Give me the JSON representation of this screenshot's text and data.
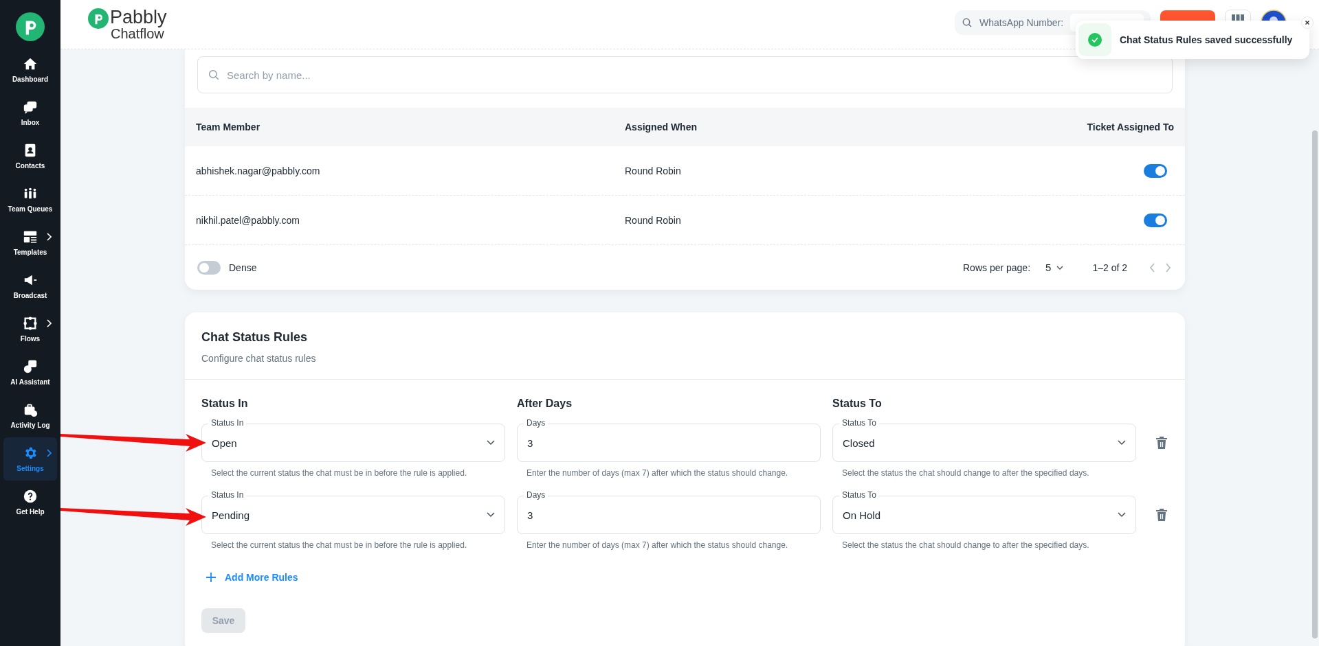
{
  "sidebar": {
    "items": [
      {
        "label": "Dashboard",
        "selected": false,
        "has_submenu": false
      },
      {
        "label": "Inbox",
        "selected": false,
        "has_submenu": false
      },
      {
        "label": "Contacts",
        "selected": false,
        "has_submenu": false
      },
      {
        "label": "Team Queues",
        "selected": false,
        "has_submenu": false
      },
      {
        "label": "Templates",
        "selected": false,
        "has_submenu": true
      },
      {
        "label": "Broadcast",
        "selected": false,
        "has_submenu": false
      },
      {
        "label": "Flows",
        "selected": false,
        "has_submenu": true
      },
      {
        "label": "AI Assistant",
        "selected": false,
        "has_submenu": false
      },
      {
        "label": "Activity Log",
        "selected": false,
        "has_submenu": false
      },
      {
        "label": "Settings",
        "selected": true,
        "has_submenu": true
      },
      {
        "label": "Get Help",
        "selected": false,
        "has_submenu": false
      }
    ]
  },
  "header": {
    "logo_name": "Pabbly",
    "logo_product": "Chatflow",
    "search_label": "WhatsApp Number:"
  },
  "toast": {
    "message": "Chat Status Rules saved successfully"
  },
  "team_table": {
    "search": {
      "placeholder": "Search by name..."
    },
    "columns": [
      "Team Member",
      "Assigned When",
      "Ticket Assigned To"
    ],
    "rows": [
      {
        "member": "abhishek.nagar@pabbly.com",
        "assigned_when": "Round Robin",
        "on": true
      },
      {
        "member": "nikhil.patel@pabbly.com",
        "assigned_when": "Round Robin",
        "on": true
      }
    ],
    "dense": {
      "label": "Dense",
      "on": false
    },
    "rows_per_page_label": "Rows per page:",
    "rows_per_page": "5",
    "range": "1–2 of 2"
  },
  "chat_status_rules": {
    "title": "Chat Status Rules",
    "subtitle": "Configure chat status rules",
    "columns": [
      "Status In",
      "After Days",
      "Status To"
    ],
    "rules": [
      {
        "status_in": {
          "label": "Status In",
          "value": "Open",
          "helper": "Select the current status the chat must be in before the rule is applied."
        },
        "days": {
          "label": "Days",
          "value": "3",
          "helper": "Enter the number of days (max 7) after which the status should change."
        },
        "status_to": {
          "label": "Status To",
          "value": "Closed",
          "helper": "Select the status the chat should change to after the specified days."
        }
      },
      {
        "status_in": {
          "label": "Status In",
          "value": "Pending",
          "helper": "Select the current status the chat must be in before the rule is applied."
        },
        "days": {
          "label": "Days",
          "value": "3",
          "helper": "Enter the number of days (max 7) after which the status should change."
        },
        "status_to": {
          "label": "Status To",
          "value": "On Hold",
          "helper": "Select the status the chat should change to after the specified days."
        }
      }
    ],
    "add_label": "Add More Rules",
    "save": {
      "label": "Save",
      "disabled": true
    }
  }
}
